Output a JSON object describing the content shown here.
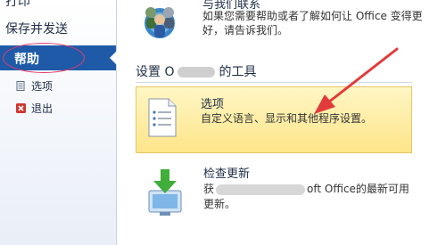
{
  "nav": {
    "top_partial": "打印",
    "save_send": "保存并发送",
    "help": "帮助",
    "options": "选项",
    "exit": "退出"
  },
  "contact": {
    "title": "与我们联系",
    "desc": "如果您需要帮助或者了解如何让 Office 变得更好，请告诉我们。"
  },
  "section": {
    "header_left": "设置",
    "header_partial": "O",
    "header_right": "的工具"
  },
  "options_card": {
    "title": "选项",
    "desc": "自定义语言、显示和其他程序设置。"
  },
  "updates_card": {
    "title": "检查更新",
    "desc_left": "获",
    "desc_mid": "oft Office",
    "desc_right": "的最新可用更新。"
  },
  "colors": {
    "help_bg": "#1e5aa8",
    "card_bg": "#fde58a",
    "annotation_red": "#e23b3b"
  }
}
